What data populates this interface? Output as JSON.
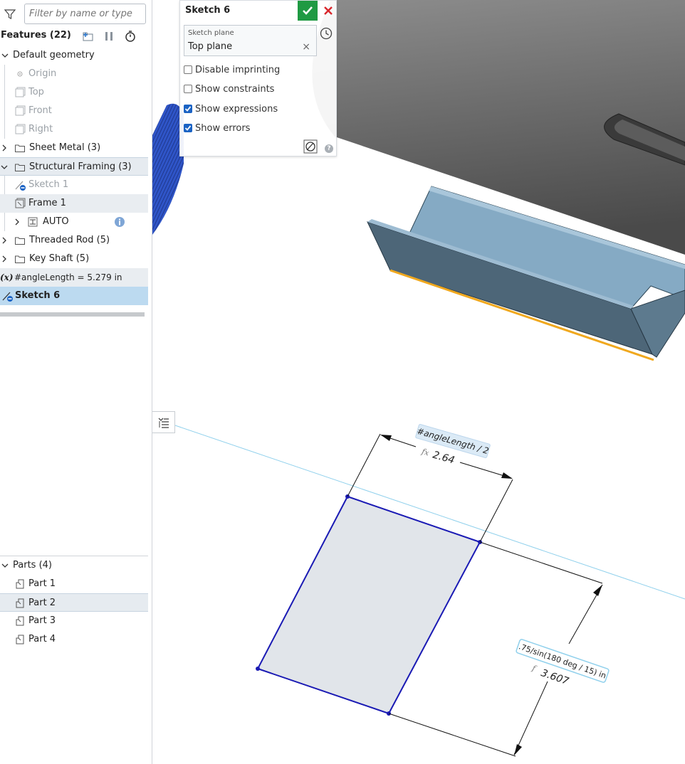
{
  "filter": {
    "placeholder": "Filter by name or type"
  },
  "features": {
    "label": "Features (22)"
  },
  "tree": {
    "default_geometry": "Default geometry",
    "origin": "Origin",
    "top": "Top",
    "front": "Front",
    "right": "Right",
    "sheet_metal": "Sheet Metal (3)",
    "structural_framing": "Structural Framing (3)",
    "sketch1": "Sketch 1",
    "frame1": "Frame 1",
    "auto": "AUTO",
    "threaded_rod": "Threaded Rod (5)",
    "key_shaft": "Key Shaft (5)",
    "variable": "#angleLength = 5.279 in",
    "sketch6": "Sketch 6"
  },
  "parts": {
    "header": "Parts (4)",
    "items": [
      "Part 1",
      "Part 2",
      "Part 3",
      "Part 4"
    ]
  },
  "dialog": {
    "title": "Sketch 6",
    "sketch_plane_caption": "Sketch plane",
    "sketch_plane_value": "Top plane",
    "options": [
      {
        "label": "Disable imprinting",
        "checked": false
      },
      {
        "label": "Show constraints",
        "checked": false
      },
      {
        "label": "Show expressions",
        "checked": true
      },
      {
        "label": "Show errors",
        "checked": true
      }
    ],
    "help": "?"
  },
  "dimensions": {
    "dim1_expression": "#angleLength / 2",
    "dim1_value": "2.64",
    "dim2_expression": ".75/sin(180 deg / 15) in",
    "dim2_value": "3.607"
  },
  "colors": {
    "accent_blue": "#1b63c4",
    "ok_green": "#1f9a43",
    "cancel_red": "#d9262c",
    "sketch_blue": "#1a1ab4",
    "sheet_metal_blue": "#7fa8c4",
    "highlight_edge": "#f0a81e",
    "selection_bg": "#bcdaf0"
  }
}
